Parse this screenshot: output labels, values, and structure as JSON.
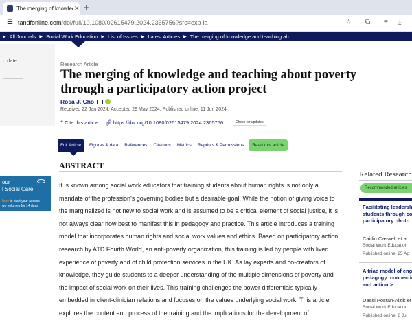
{
  "browser": {
    "tab_title": "The merging of knowledge and teaching about poverty",
    "tab_close": "✕",
    "new_tab": "+",
    "url_host": "tandfonline.com",
    "url_path": "/doi/full/10.1080/02615479.2024.2365756?src=exp-la"
  },
  "breadcrumb": [
    "All Journals",
    "Social Work Education",
    "List of Issues",
    "Latest Articles",
    "The merging of knowledge and teaching ab ...."
  ],
  "left_panel": {
    "date_label": "o date"
  },
  "article": {
    "type": "Research Article",
    "title": "The merging of knowledge and teaching about poverty through a participatory action project",
    "author": "Rosa J. Cho",
    "dates": "Received 22 Jan 2024, Accepted 29 May 2024, Published online: 11 Jun 2024",
    "cite": "Cite this article",
    "doi": "https://doi.org/10.1080/02615479.2024.2365756",
    "check_updates": "Check for updates"
  },
  "tabs": {
    "full": "Full Article",
    "figures": "Figures & data",
    "references": "References",
    "citations": "Citations",
    "metrics": "Metrics",
    "reprints": "Reprints & Permissions",
    "read": "Read this article"
  },
  "abstract": {
    "heading": "ABSTRACT",
    "text": "It is known among social work educators that training students about human rights is not only a mandate of the profession's governing bodies but a desirable goal. While the notion of giving voice to the marginalized is not new to social work and is assumed to be a critical element of social justice, it is not always clear how best to manifest this in pedagogy and practice. This article introduces a training model that incorporates human rights and social work values and ethics. Based on participatory action research by ATD Fourth World, an anti-poverty organization, this training is led by people with lived experience of poverty and of child protection services in the UK. As lay experts and co-creators of knowledge, they guide students to a deeper understanding of the multiple dimensions of poverty and the impact of social work on their lives. This training challenges the power differentials typically embedded in client-clinician relations and focuses on the values underlying social work. This article explores the content and process of the training and the implications for the development of"
  },
  "ad": {
    "line1": "our",
    "line2": "l Social Care",
    "line3_highlight": "here",
    "line3_rest": " to start your access",
    "line4": "wo volumes for 14 days"
  },
  "related": {
    "heading": "Related Research",
    "recommended_btn": "Recommended articles",
    "items": [
      {
        "title_lines": [
          "Facilitating leadership",
          "students through co",
          "participatory photo"
        ],
        "author": "Caitlin Caswell et al.",
        "journal": "Social Work Education",
        "published": "Published online: 25 Ap"
      },
      {
        "title_lines": [
          "A triad model of eng",
          "pedagogy: connectin",
          "and action"
        ],
        "arrow": ">",
        "author": "Dassi Postan-Aizik et",
        "journal": "Social Work Education",
        "published": "Published online: 8 Ju"
      }
    ]
  },
  "colors": {
    "navy": "#0f1a5c",
    "green": "#7bd36f",
    "link": "#10206c",
    "ad_blue": "#1d6fa5"
  }
}
